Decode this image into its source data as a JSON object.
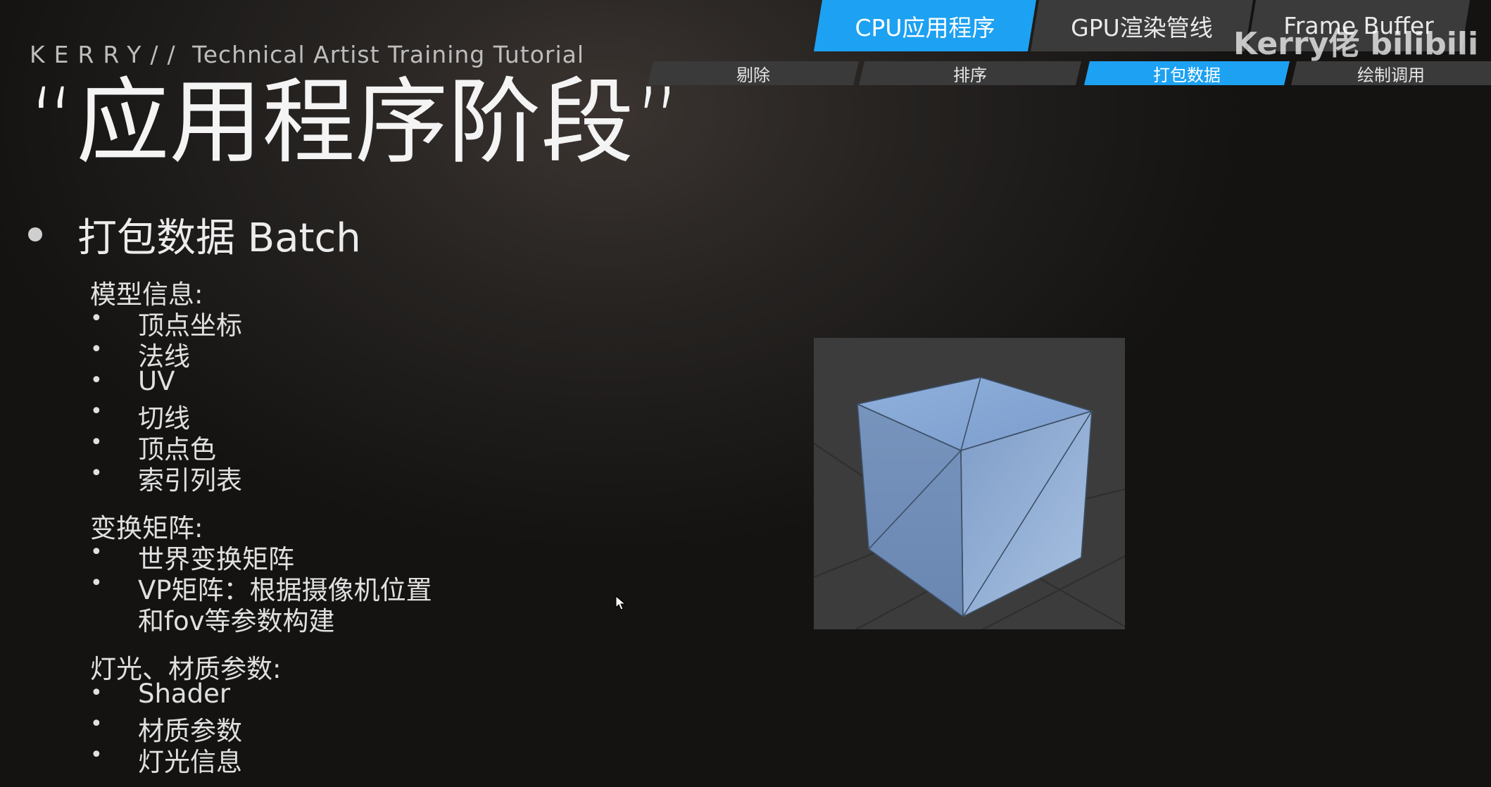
{
  "brand": {
    "name": "KERRY//",
    "subtitle": "Technical Artist Training Tutorial"
  },
  "title": "“应用程序阶段”",
  "tabs": [
    {
      "label": "CPU应用程序",
      "active": true
    },
    {
      "label": "GPU渲染管线",
      "active": false
    },
    {
      "label": "Frame Buffer",
      "active": false
    }
  ],
  "sub_tabs": [
    {
      "label": "剔除",
      "active": false
    },
    {
      "label": "排序",
      "active": false
    },
    {
      "label": "打包数据",
      "active": true
    },
    {
      "label": "绘制调用",
      "active": false
    }
  ],
  "watermark": "Kerry佬 bilibili",
  "main_bullet": "打包数据 Batch",
  "sections": [
    {
      "heading": "模型信息:",
      "items": [
        "顶点坐标",
        "法线",
        "UV",
        "切线",
        "顶点色",
        "索引列表"
      ]
    },
    {
      "heading": "变换矩阵:",
      "items": [
        "世界变换矩阵",
        "VP矩阵：根据摄像机位置",
        "和fov等参数构建"
      ]
    },
    {
      "heading": "灯光、材质参数:",
      "items": [
        "Shader",
        "材质参数",
        "灯光信息"
      ]
    }
  ],
  "colors": {
    "accent": "#1da1f2",
    "cube_fill": "#7f9fc9",
    "background": "#1b1918"
  },
  "icons": {
    "cube": "cube-wireframe-icon",
    "cursor": "mouse-cursor-icon",
    "bullet": "bullet-dot-icon"
  }
}
